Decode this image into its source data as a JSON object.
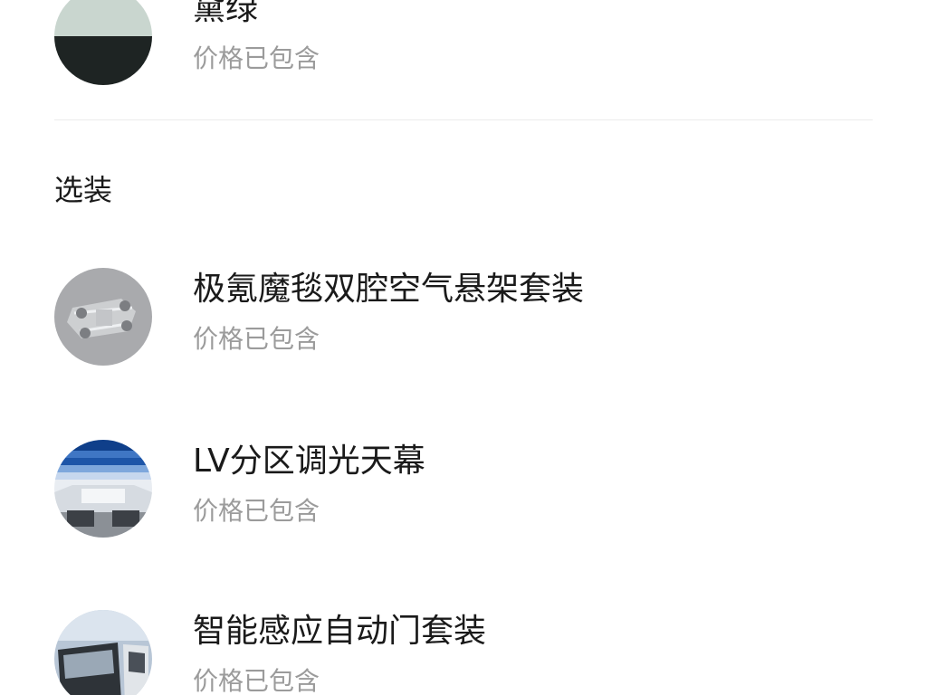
{
  "color_option": {
    "name": "黛绿",
    "price_note": "价格已包含",
    "swatch_top": "#c9d6cf",
    "swatch_bottom": "#1e2423"
  },
  "options_section": {
    "heading": "选装",
    "items": [
      {
        "name": "极氪魔毯双腔空气悬架套装",
        "price_note": "价格已包含"
      },
      {
        "name": "LV分区调光天幕",
        "price_note": "价格已包含"
      },
      {
        "name": "智能感应自动门套装",
        "price_note": "价格已包含"
      }
    ]
  },
  "colors": {
    "title_text": "#1a1a1a",
    "secondary_text": "#9b9b9b",
    "divider": "#ececec"
  }
}
